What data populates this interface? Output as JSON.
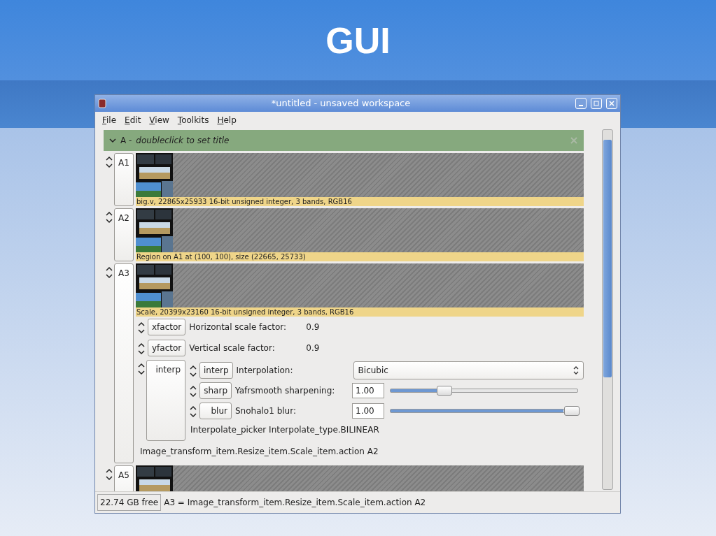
{
  "slide": {
    "title": "GUI"
  },
  "window": {
    "title": "*untitled - unsaved workspace"
  },
  "menu": [
    "File",
    "Edit",
    "View",
    "Toolkits",
    "Help"
  ],
  "column": {
    "name": "A -",
    "title": "doubleclick to set title"
  },
  "rows": [
    {
      "name": "A1",
      "caption": "big.v, 22865x25933 16-bit unsigned integer, 3 bands, RGB16"
    },
    {
      "name": "A2",
      "caption": "Region on A1 at (100, 100), size (22665, 25733)"
    },
    {
      "name": "A3",
      "caption": "Scale, 20399x23160 16-bit unsigned integer, 3 bands, RGB16",
      "params": [
        {
          "kind": "value",
          "name": "xfactor",
          "label": "Horizontal scale factor:",
          "value": "0.9"
        },
        {
          "kind": "value",
          "name": "yfactor",
          "label": "Vertical scale factor:",
          "value": "0.9"
        },
        {
          "kind": "group",
          "name": "interp",
          "footer": "Interpolate_picker Interpolate_type.BILINEAR",
          "children": [
            {
              "kind": "option",
              "name": "interp",
              "label": "Interpolation:",
              "value": "Bicubic"
            },
            {
              "kind": "slider",
              "name": "sharp",
              "label": "Yafrsmooth sharpening:",
              "value": "1.00",
              "level": 0.27
            },
            {
              "kind": "slider",
              "name": "blur",
              "label": "Snohalo1 blur:",
              "value": "1.00",
              "level": 1.0
            }
          ]
        }
      ],
      "footer": "Image_transform_item.Resize_item.Scale_item.action A2"
    },
    {
      "name": "A5"
    }
  ],
  "status_bar": {
    "free": "22.74 GB free",
    "message": "A3 = Image_transform_item.Resize_item.Scale_item.action A2"
  }
}
